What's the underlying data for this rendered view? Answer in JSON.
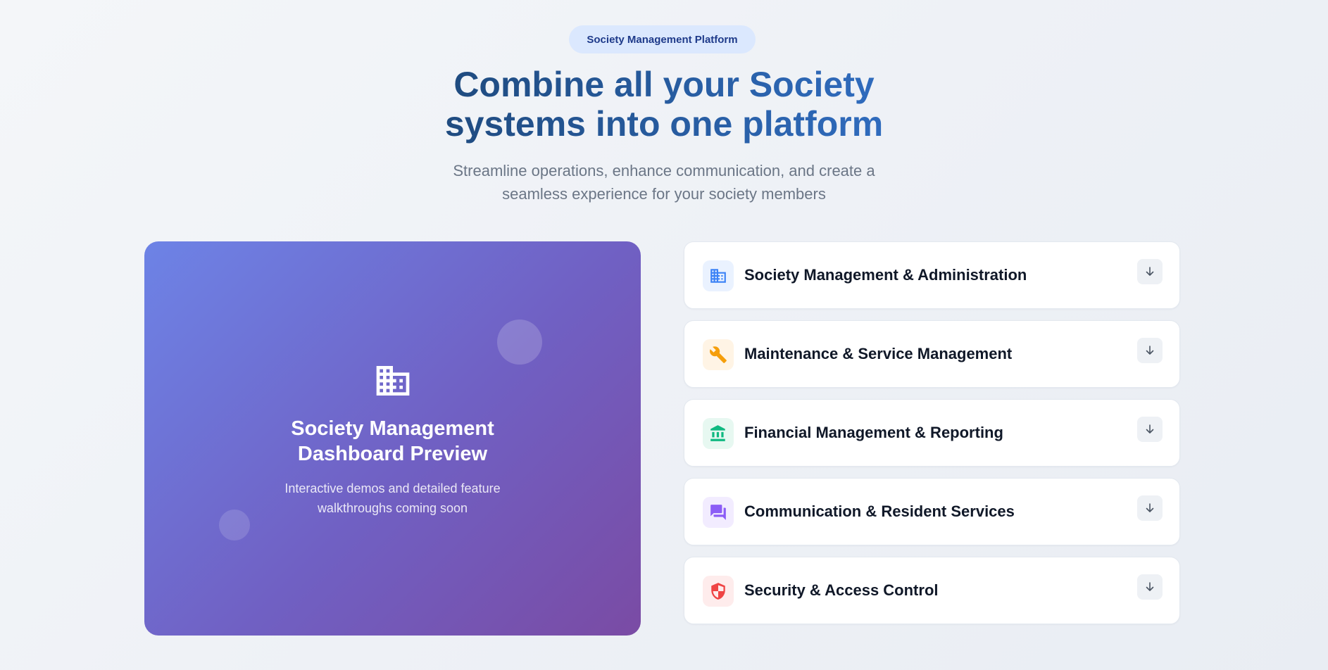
{
  "badge": "Society Management Platform",
  "hero": {
    "title_line1": "Combine all your Society",
    "title_line2": "systems into one platform",
    "subtitle_line1": "Streamline operations, enhance communication, and create a",
    "subtitle_line2": "seamless experience for your society members"
  },
  "preview": {
    "icon": "building-icon",
    "title_line1": "Society Management",
    "title_line2": "Dashboard Preview",
    "desc_line1": "Interactive demos and detailed feature",
    "desc_line2": "walkthroughs coming soon"
  },
  "features": [
    {
      "label": "Society Management & Administration",
      "icon": "building-icon",
      "color": "#3b82f6",
      "bg": "#eaf2ff"
    },
    {
      "label": "Maintenance & Service Management",
      "icon": "wrench-icon",
      "color": "#f59e0b",
      "bg": "#fff4e5"
    },
    {
      "label": "Financial Management & Reporting",
      "icon": "bank-icon",
      "color": "#10b981",
      "bg": "#e7f8f1"
    },
    {
      "label": "Communication & Resident Services",
      "icon": "chat-icon",
      "color": "#8b5cf6",
      "bg": "#f2ecff"
    },
    {
      "label": "Security & Access Control",
      "icon": "shield-icon",
      "color": "#ef4444",
      "bg": "#feecec"
    }
  ]
}
